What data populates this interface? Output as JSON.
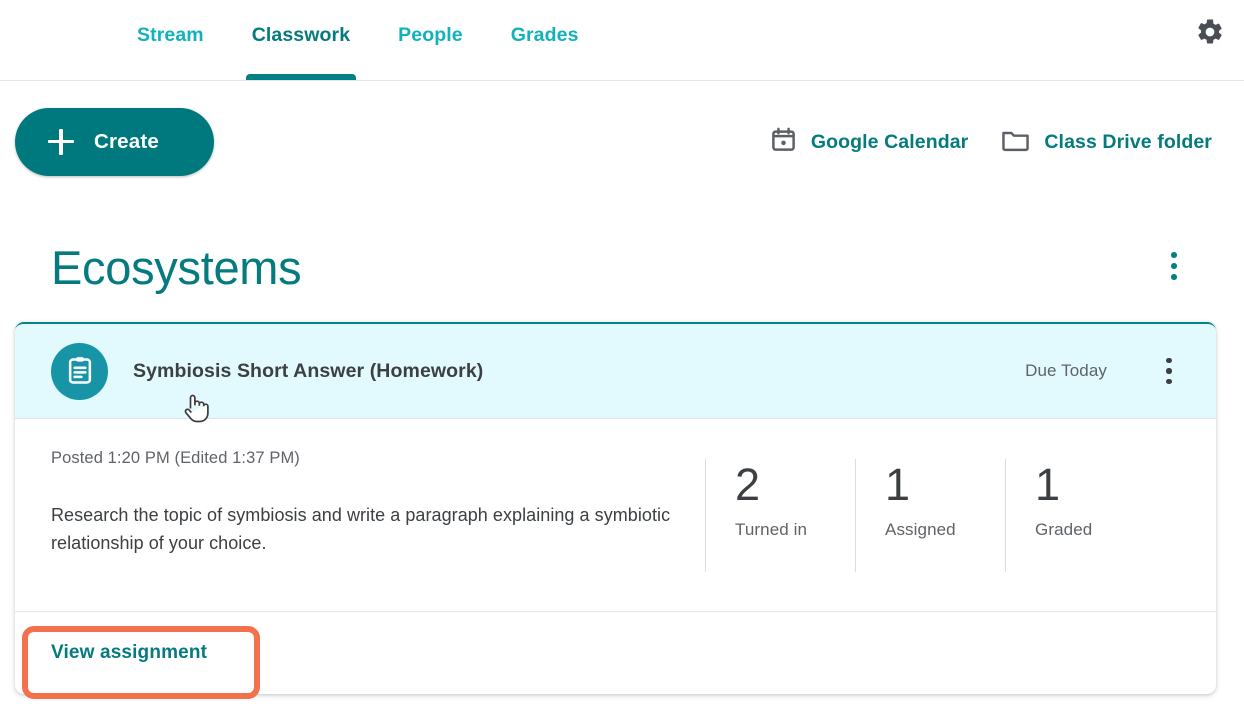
{
  "nav": {
    "tabs": [
      {
        "label": "Stream",
        "active": false
      },
      {
        "label": "Classwork",
        "active": true
      },
      {
        "label": "People",
        "active": false
      },
      {
        "label": "Grades",
        "active": false
      }
    ],
    "settings_icon": "gear-icon"
  },
  "actionbar": {
    "create_label": "Create",
    "create_icon": "plus-icon",
    "links": [
      {
        "label": "Google Calendar",
        "icon": "calendar-icon"
      },
      {
        "label": "Class Drive folder",
        "icon": "folder-icon"
      }
    ]
  },
  "topic": {
    "title": "Ecosystems",
    "menu_icon": "more-vert-icon"
  },
  "assignment": {
    "icon": "assignment-clipboard-icon",
    "title": "Symbiosis Short Answer (Homework)",
    "due": "Due Today",
    "menu_icon": "more-vert-icon",
    "posted": "Posted 1:20 PM (Edited 1:37 PM)",
    "description": "Research the topic of symbiosis and write a paragraph explaining a symbiotic relationship of your choice.",
    "stats": [
      {
        "value": "2",
        "label": "Turned in"
      },
      {
        "value": "1",
        "label": "Assigned"
      },
      {
        "value": "1",
        "label": "Graded"
      }
    ],
    "view_label": "View assignment"
  },
  "colors": {
    "teal_dark": "#057b7f",
    "teal_bright": "#12b2ba",
    "teal_button": "#00797e",
    "card_header_bg": "#e2fafd",
    "highlight": "#f4714d",
    "text_primary": "#3c4043",
    "text_secondary": "#5f6368"
  }
}
